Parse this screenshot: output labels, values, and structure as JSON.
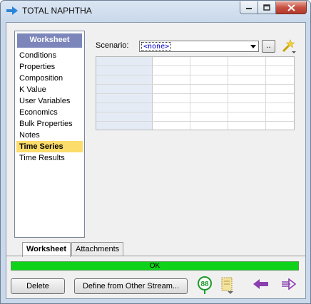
{
  "window": {
    "title": "TOTAL NAPHTHA"
  },
  "nav": {
    "header": "Worksheet",
    "items": [
      {
        "label": "Conditions"
      },
      {
        "label": "Properties"
      },
      {
        "label": "Composition"
      },
      {
        "label": "K Value"
      },
      {
        "label": "User Variables"
      },
      {
        "label": "Economics"
      },
      {
        "label": "Bulk Properties"
      },
      {
        "label": "Notes"
      },
      {
        "label": "Time Series",
        "selected": true
      },
      {
        "label": "Time Results"
      }
    ]
  },
  "scenario": {
    "label": "Scenario:",
    "value": "<none>",
    "browse_label": ".."
  },
  "tabs": [
    {
      "label": "Worksheet",
      "active": true
    },
    {
      "label": "Attachments"
    }
  ],
  "status": {
    "text": "OK",
    "color": "#0fd31a"
  },
  "buttons": {
    "delete": "Delete",
    "define_from": "Define from Other Stream...",
    "badge_number": "88"
  },
  "icons": {
    "title": "stream-arrow-icon",
    "scenario_tool": "magic-wand-icon",
    "nav_back": "purple-left-arrow-icon",
    "nav_forward": "purple-right-arrow-icon"
  }
}
